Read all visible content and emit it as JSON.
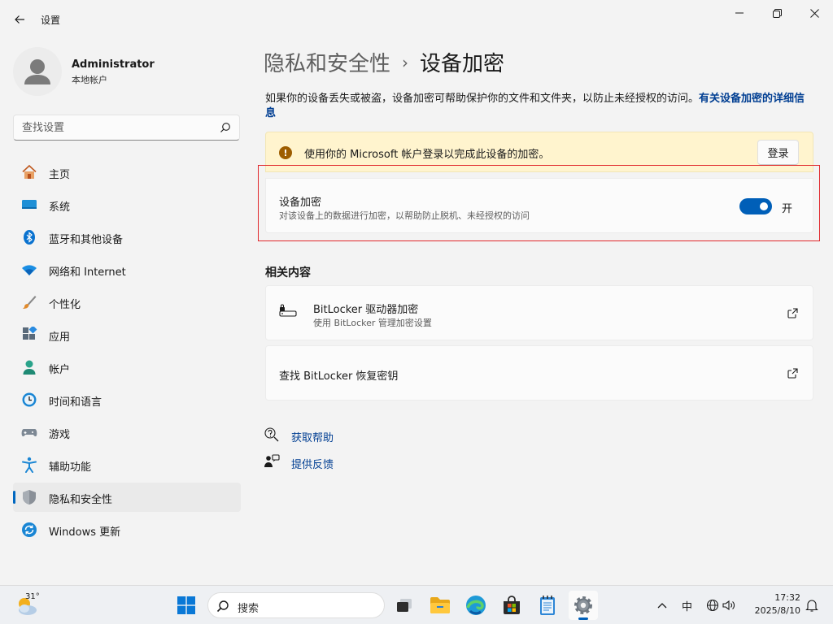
{
  "window": {
    "title": "设置"
  },
  "user": {
    "name": "Administrator",
    "account_type": "本地帐户"
  },
  "search": {
    "placeholder": "查找设置"
  },
  "nav": [
    {
      "label": "主页",
      "icon": "home-icon"
    },
    {
      "label": "系统",
      "icon": "display-icon"
    },
    {
      "label": "蓝牙和其他设备",
      "icon": "bluetooth-icon"
    },
    {
      "label": "网络和 Internet",
      "icon": "wifi-icon"
    },
    {
      "label": "个性化",
      "icon": "brush-icon"
    },
    {
      "label": "应用",
      "icon": "apps-icon"
    },
    {
      "label": "帐户",
      "icon": "person-icon"
    },
    {
      "label": "时间和语言",
      "icon": "clock-globe-icon"
    },
    {
      "label": "游戏",
      "icon": "gamepad-icon"
    },
    {
      "label": "辅助功能",
      "icon": "accessibility-icon"
    },
    {
      "label": "隐私和安全性",
      "icon": "shield-icon",
      "active": true
    },
    {
      "label": "Windows 更新",
      "icon": "update-icon"
    }
  ],
  "breadcrumb": {
    "parent": "隐私和安全性",
    "separator": "›",
    "current": "设备加密"
  },
  "description": {
    "text": "如果你的设备丢失或被盗，设备加密可帮助保护你的文件和文件夹，以防止未经授权的访问。",
    "link": "有关设备加密的详细信息"
  },
  "warning": {
    "text": "使用你的 Microsoft 帐户登录以完成此设备的加密。",
    "button": "登录"
  },
  "encryption": {
    "title": "设备加密",
    "subtitle": "对该设备上的数据进行加密，以帮助防止脱机、未经授权的访问",
    "toggle_on": true,
    "toggle_label": "开"
  },
  "related": {
    "title": "相关内容",
    "items": [
      {
        "title": "BitLocker 驱动器加密",
        "subtitle": "使用 BitLocker 管理加密设置"
      },
      {
        "title": "查找 BitLocker 恢复密钥",
        "subtitle": ""
      }
    ]
  },
  "help_links": {
    "get_help": "获取帮助",
    "feedback": "提供反馈"
  },
  "taskbar": {
    "temperature": "31°",
    "search_placeholder": "搜索",
    "ime": "中",
    "time": "17:32",
    "date": "2025/8/10"
  },
  "colors": {
    "accent": "#005fb8",
    "warning_bg": "#fff4ce",
    "highlight_frame": "#e0262b",
    "link": "#003e92"
  }
}
